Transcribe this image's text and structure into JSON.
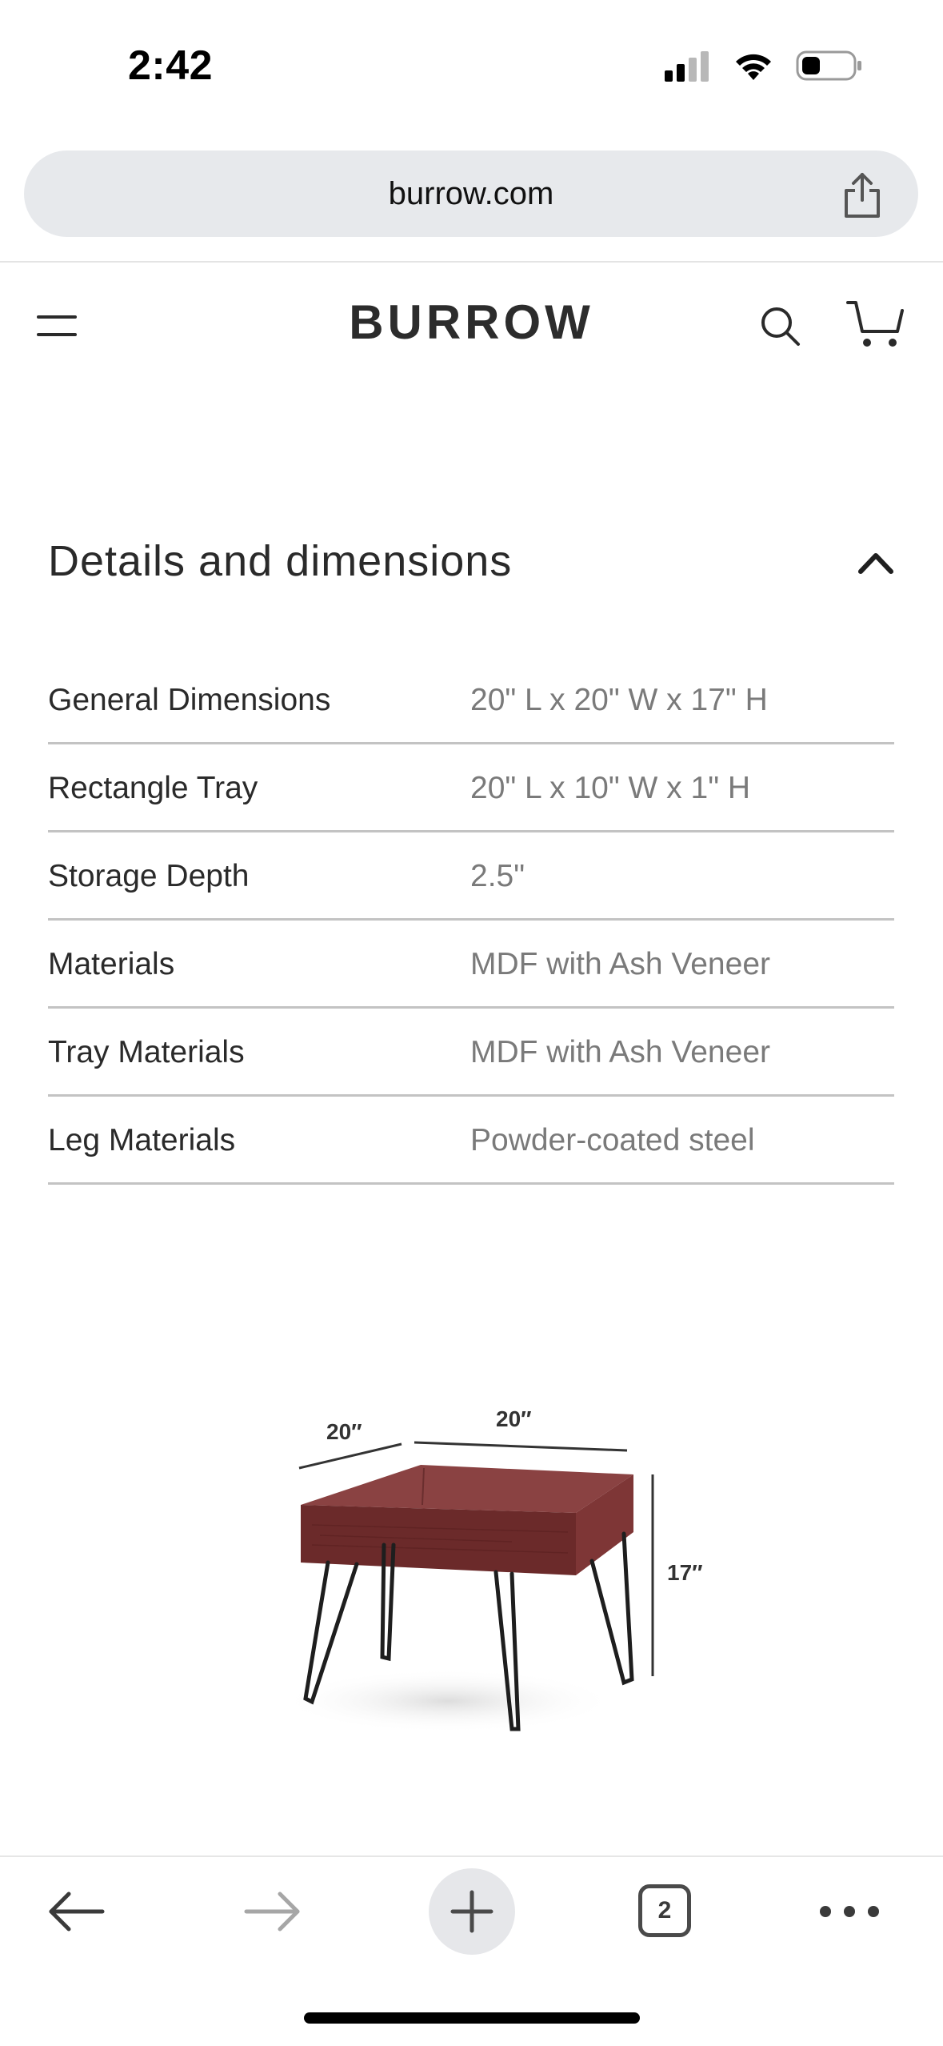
{
  "status_bar": {
    "time": "2:42",
    "icons": [
      "signal-icon",
      "wifi-icon",
      "battery-icon"
    ]
  },
  "browser": {
    "url": "burrow.com"
  },
  "header": {
    "logo": "BURROW"
  },
  "section": {
    "title": "Details and dimensions"
  },
  "specs": [
    {
      "label": "General Dimensions",
      "value": "20\" L x 20\" W x 17\" H"
    },
    {
      "label": "Rectangle Tray",
      "value": "20\" L x 10\" W x 1\" H"
    },
    {
      "label": "Storage Depth",
      "value": "2.5\""
    },
    {
      "label": "Materials",
      "value": "MDF with Ash Veneer"
    },
    {
      "label": "Tray Materials",
      "value": "MDF with Ash Veneer"
    },
    {
      "label": "Leg Materials",
      "value": "Powder-coated steel"
    }
  ],
  "product_image": {
    "depth_label": "20″",
    "width_label": "20″",
    "height_label": "17″"
  },
  "toolbar": {
    "tab_count": "2"
  },
  "colors": {
    "wood": "#7a3535",
    "wood_dark": "#5e2424",
    "leg": "#1e1e1e"
  }
}
